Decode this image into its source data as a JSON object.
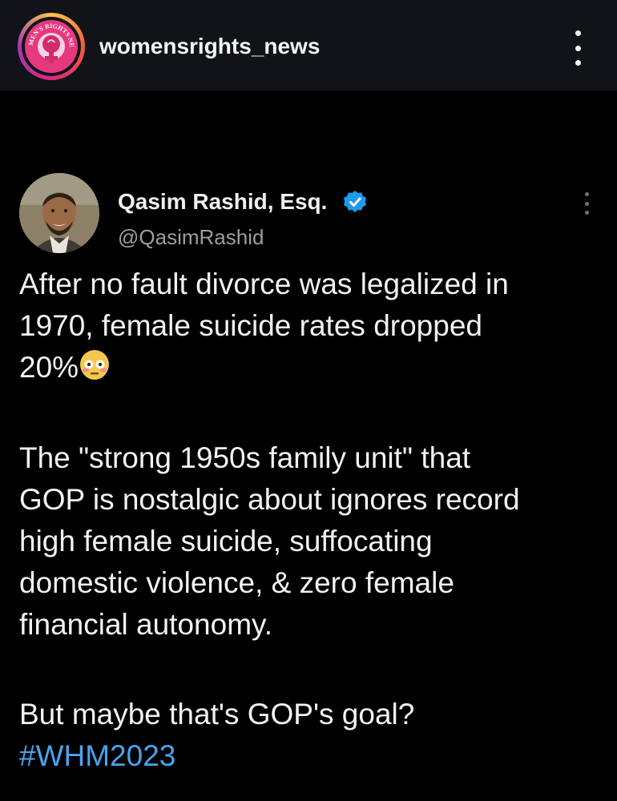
{
  "header": {
    "username": "womensrights_news",
    "avatar_text": "WOMEN'S RIGHTS NEWS",
    "more_icon": "more-vertical-icon"
  },
  "tweet": {
    "author_name": "Qasim Rashid, Esq.",
    "handle": "@QasimRashid",
    "verified_icon": "verified-badge-icon",
    "more_icon": "more-vertical-icon",
    "lines": [
      "After no fault divorce was legalized in",
      "1970, female suicide rates dropped",
      "20%",
      "The \"strong 1950s family unit\" that",
      "GOP is nostalgic about ignores record",
      "high female suicide, suffocating",
      "domestic violence, & zero female",
      "financial autonomy.",
      "But maybe that's GOP's goal?"
    ],
    "emoji": "flushed-face-emoji",
    "hashtag": "#WHM2023"
  },
  "colors": {
    "background": "#000000",
    "header_bg": "#111318",
    "text": "#f2f2f2",
    "handle": "#9a9ea3",
    "hashtag": "#4aa3ee",
    "verified": "#1d9bf0"
  }
}
